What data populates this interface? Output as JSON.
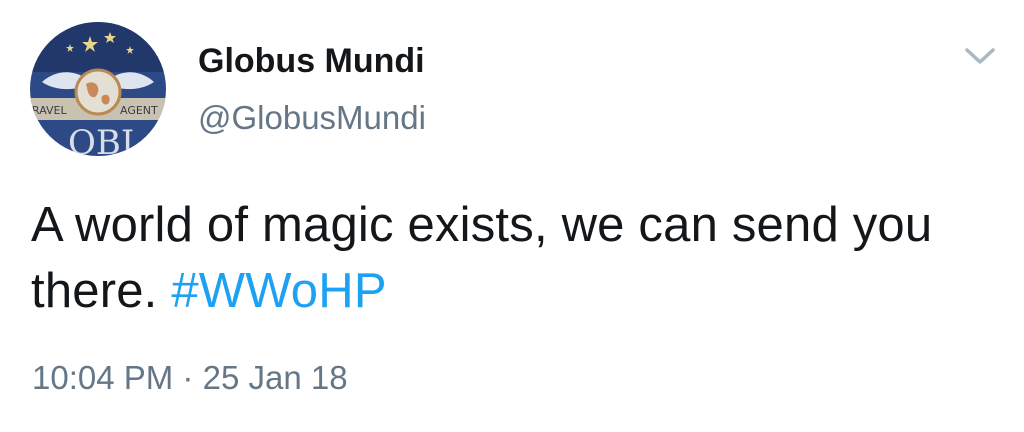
{
  "user": {
    "display_name": "Globus Mundi",
    "handle": "@GlobusMundi",
    "avatar_text_left": "RAVEL",
    "avatar_text_right": "AGENT",
    "avatar_text_bottom": "OBI"
  },
  "tweet": {
    "text": "A world of magic exists, we can send you there.",
    "hashtag": "#WWoHP",
    "time": "10:04 PM",
    "separator": "·",
    "date": "25 Jan 18"
  },
  "icons": {
    "menu": "chevron-down-icon"
  },
  "colors": {
    "text": "#14171a",
    "secondary": "#657786",
    "link": "#1da1f2",
    "caret": "#aab8c2"
  }
}
